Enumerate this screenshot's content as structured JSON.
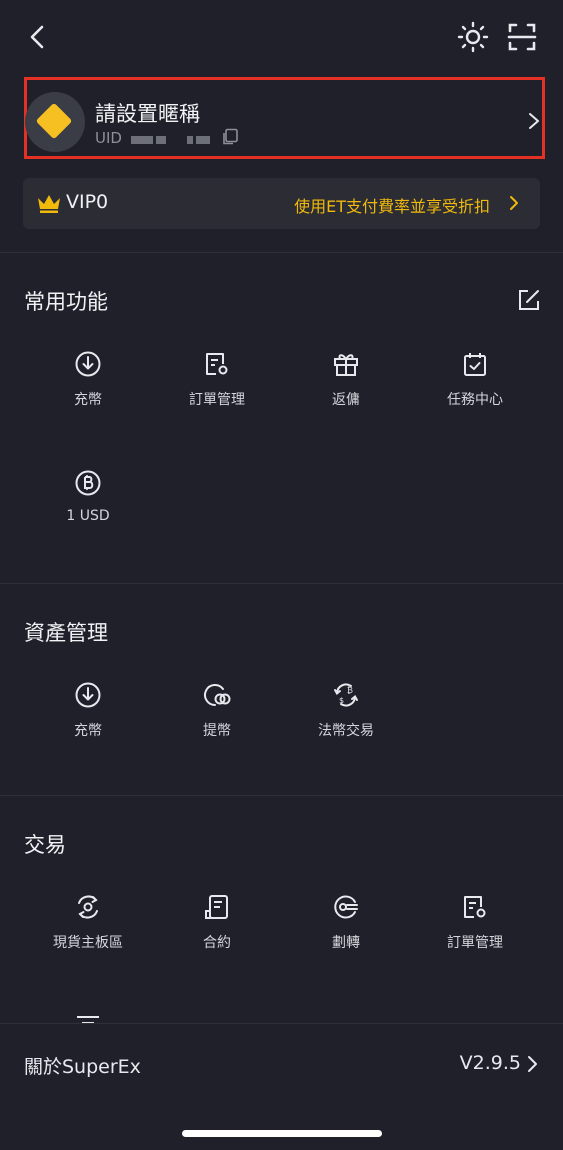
{
  "header": {
    "back_icon": "chevron-left-icon",
    "theme_icon": "sun-icon",
    "scan_icon": "scan-icon"
  },
  "profile": {
    "nickname": "請設置暱稱",
    "uid_label": "UID",
    "avatar_icon": "diamond-logo",
    "highlight_color": "#e53123"
  },
  "vip": {
    "level": "VIP0",
    "promo": "使用ET支付費率並享受折扣",
    "accent_color": "#f0b90b"
  },
  "common_functions": {
    "title": "常用功能",
    "items": [
      {
        "label": "充幣",
        "icon": "deposit-icon"
      },
      {
        "label": "訂單管理",
        "icon": "order-icon"
      },
      {
        "label": "返傭",
        "icon": "gift-icon"
      },
      {
        "label": "任務中心",
        "icon": "task-calendar-icon"
      },
      {
        "label": "1 USD",
        "icon": "bitcoin-icon"
      }
    ]
  },
  "asset_management": {
    "title": "資產管理",
    "items": [
      {
        "label": "充幣",
        "icon": "deposit-icon"
      },
      {
        "label": "提幣",
        "icon": "withdraw-icon"
      },
      {
        "label": "法幣交易",
        "icon": "fiat-exchange-icon"
      }
    ]
  },
  "trading": {
    "title": "交易",
    "items": [
      {
        "label": "現貨主板區",
        "icon": "spot-icon"
      },
      {
        "label": "合約",
        "icon": "contract-icon"
      },
      {
        "label": "劃轉",
        "icon": "transfer-icon"
      },
      {
        "label": "訂單管理",
        "icon": "order-icon"
      }
    ]
  },
  "footer": {
    "about": "關於SuperEx",
    "version": "V2.9.5"
  }
}
